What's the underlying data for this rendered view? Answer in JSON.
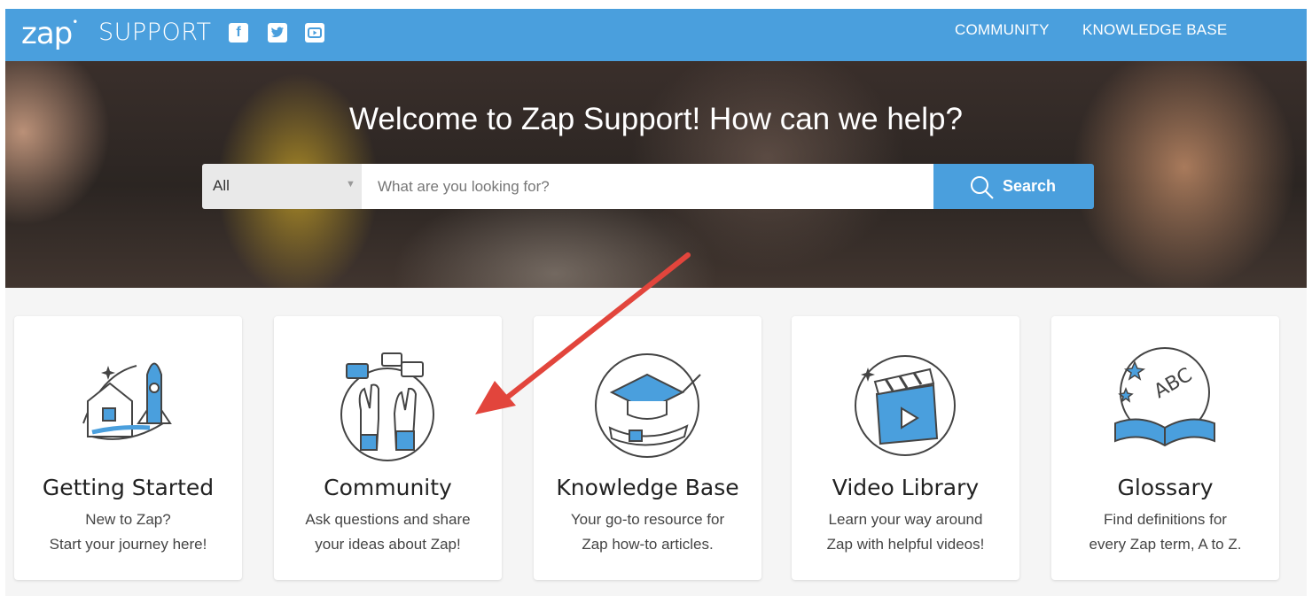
{
  "header": {
    "logo_text": "zap",
    "logo_dot": "•",
    "logo_subtitle": "SUPPORT",
    "social": [
      {
        "name": "facebook-icon",
        "glyph": "f"
      },
      {
        "name": "twitter-icon",
        "glyph": "t"
      },
      {
        "name": "youtube-icon",
        "glyph": "▶"
      }
    ],
    "nav": {
      "community": "COMMUNITY",
      "knowledge_base": "KNOWLEDGE BASE"
    }
  },
  "hero": {
    "title": "Welcome to Zap Support! How can we help?",
    "search": {
      "scope_value": "All",
      "placeholder": "What are you looking for?",
      "button_label": "Search"
    }
  },
  "cards": [
    {
      "title": "Getting Started",
      "line1": "New to Zap?",
      "line2": "Start your journey here!",
      "icon": "rocket-house-icon"
    },
    {
      "title": "Community",
      "line1": "Ask questions and share",
      "line2": "your ideas about Zap!",
      "icon": "raised-hands-chat-icon"
    },
    {
      "title": "Knowledge Base",
      "line1": "Your go-to resource for",
      "line2": "Zap how-to articles.",
      "icon": "graduation-cap-diploma-icon"
    },
    {
      "title": "Video Library",
      "line1": "Learn your way around",
      "line2": "Zap with helpful videos!",
      "icon": "clapperboard-icon"
    },
    {
      "title": "Glossary",
      "line1": "Find definitions for",
      "line2": "every Zap term, A to Z.",
      "icon": "open-book-abc-icon"
    }
  ],
  "colors": {
    "brand_blue": "#4a9fdd",
    "annotation_arrow": "#e2453c"
  }
}
